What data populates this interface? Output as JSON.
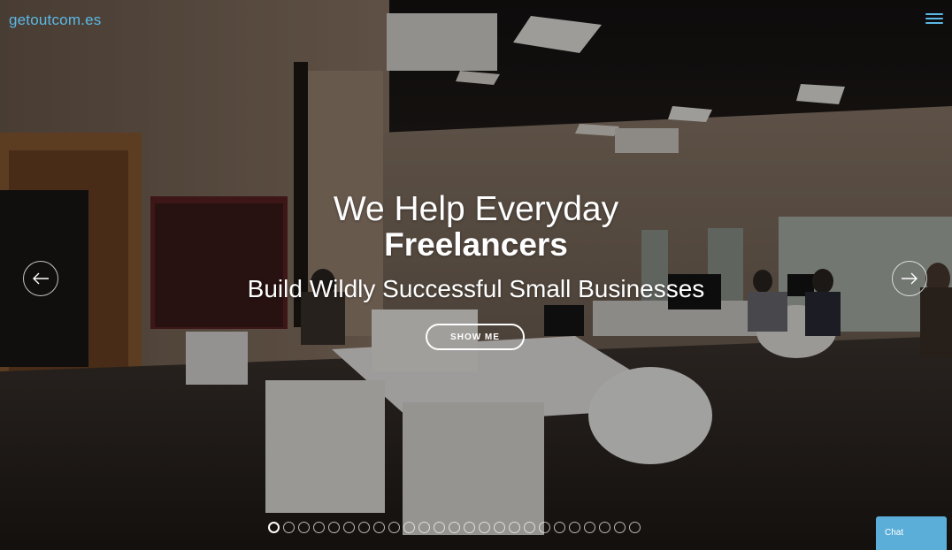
{
  "header": {
    "brand": "getoutcom.es",
    "menu_icon": "hamburger-icon"
  },
  "hero": {
    "line1": "We Help Everyday",
    "line2": "Freelancers",
    "line3": "Build Wildly Successful Small Businesses",
    "cta_label": "SHOW ME",
    "prev_icon": "arrow-left-icon",
    "next_icon": "arrow-right-icon"
  },
  "carousel": {
    "slide_count": 25,
    "active_index": 0
  },
  "chat": {
    "label": "Chat"
  },
  "colors": {
    "accent": "#5bb8e6",
    "chat_bg": "#5aaed8",
    "text": "#ffffff"
  }
}
